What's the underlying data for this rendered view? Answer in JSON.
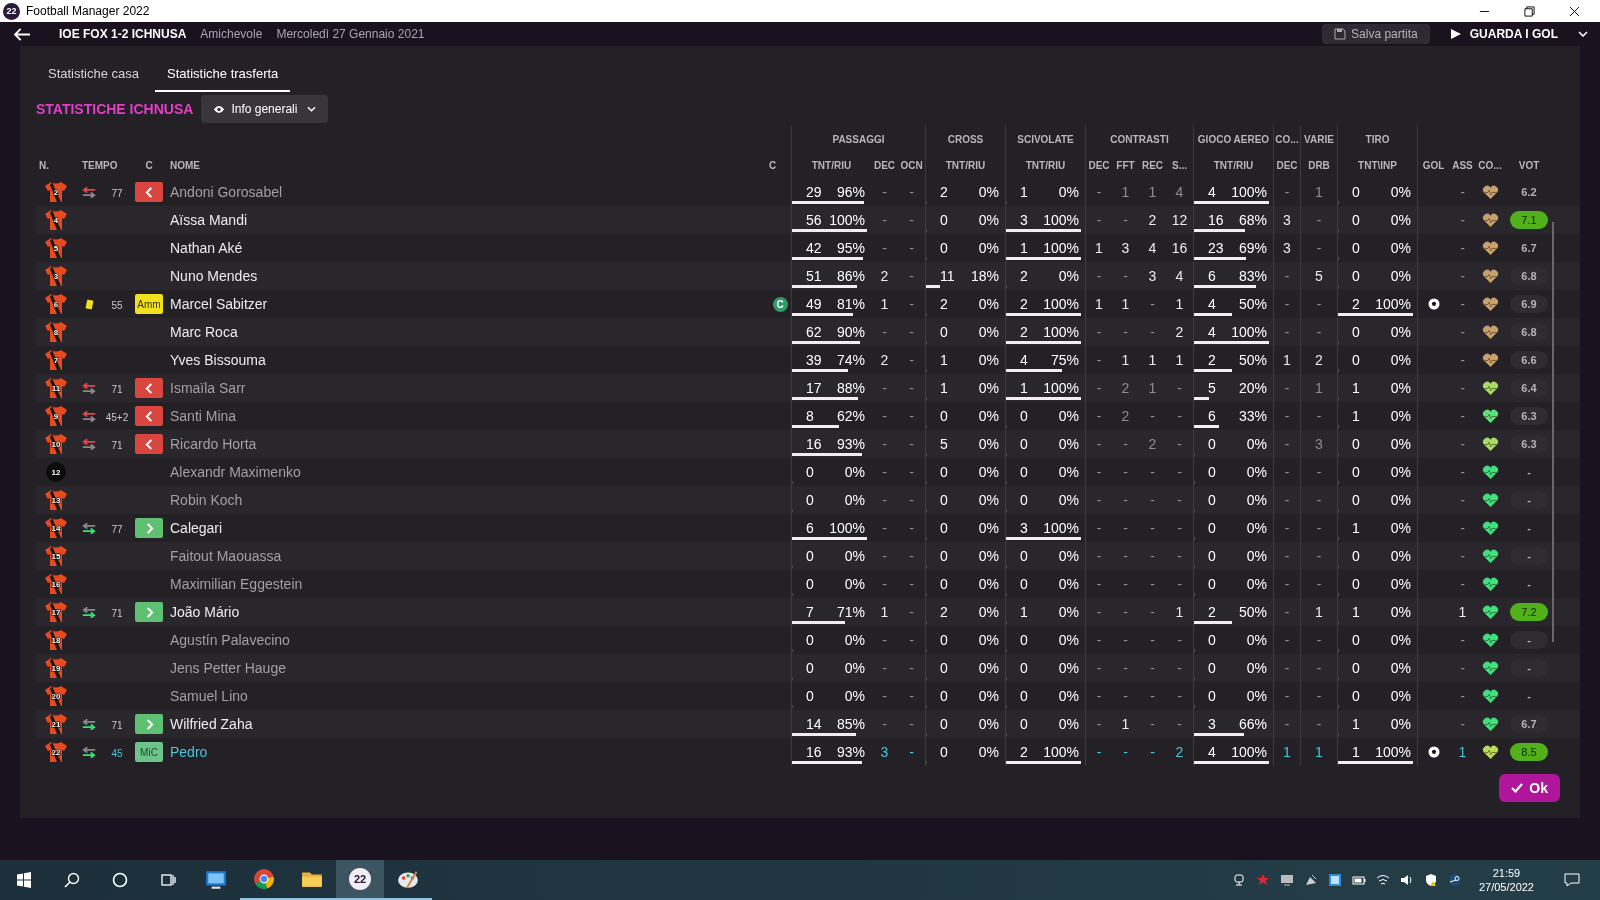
{
  "window": {
    "icon_text": "22",
    "title": "Football Manager 2022"
  },
  "match_header": {
    "score": "IOE FOX 1-2 ICHNUSA",
    "competition": "Amichevole",
    "date": "Mercoledì 27 Gennaio 2021",
    "save_button": "Salva partita",
    "goals_button": "GUARDA I GOL"
  },
  "tabs": [
    {
      "label": "Statistiche casa",
      "selected": false
    },
    {
      "label": "Statistiche trasferta",
      "selected": true
    }
  ],
  "team_title": "STATISTICHE ICHNUSA",
  "view_dropdown": {
    "value": "Info generali"
  },
  "table": {
    "left_columns": [
      "N.",
      "TEMPO",
      "C",
      "NOME",
      "C"
    ],
    "captain_label": "C",
    "groups": [
      {
        "label": "PASSAGGI",
        "columns": [
          {
            "label": "TNT/RIU",
            "kind": "bar"
          },
          {
            "label": "DEC",
            "kind": "num"
          },
          {
            "label": "OCN",
            "kind": "num"
          }
        ]
      },
      {
        "label": "CROSS",
        "columns": [
          {
            "label": "TNT/RIU",
            "kind": "bar"
          }
        ]
      },
      {
        "label": "SCIVOLATE",
        "columns": [
          {
            "label": "TNT/RIU",
            "kind": "bar"
          }
        ]
      },
      {
        "label": "CONTRASTI",
        "columns": [
          {
            "label": "DEC",
            "kind": "num"
          },
          {
            "label": "FFT",
            "kind": "num"
          },
          {
            "label": "REC",
            "kind": "num"
          },
          {
            "label": "S...",
            "kind": "num"
          }
        ]
      },
      {
        "label": "GIOCO AEREO",
        "columns": [
          {
            "label": "TNT/RIU",
            "kind": "bar"
          }
        ]
      },
      {
        "label": "CO...",
        "columns": [
          {
            "label": "DEC",
            "kind": "num"
          }
        ]
      },
      {
        "label": "VARIE",
        "columns": [
          {
            "label": "DRB",
            "kind": "wide"
          }
        ]
      },
      {
        "label": "TIRO",
        "columns": [
          {
            "label": "TNT\\INP",
            "kind": "bar"
          }
        ]
      },
      {
        "columns": [
          {
            "label": "GOL",
            "kind": "goal"
          },
          {
            "label": "ASS",
            "kind": "num"
          },
          {
            "label": "CO...",
            "kind": "heart"
          },
          {
            "label": "VOT",
            "kind": "vote"
          }
        ]
      }
    ],
    "rows": [
      {
        "number": "2",
        "keeper": false,
        "sub_off": true,
        "sub_on": false,
        "booked": false,
        "minute": "77",
        "badge": {
          "kind": "sub_off"
        },
        "name": "Andoni Gorosabel",
        "dimmed": true,
        "star": false,
        "captain": false,
        "cells": [
          {
            "tries": "29",
            "rate": "96%",
            "level": 0.96
          },
          "-",
          "-",
          {
            "tries": "2",
            "rate": "0%",
            "level": 0
          },
          {
            "tries": "1",
            "rate": "0%",
            "level": 0
          },
          "-",
          "1",
          "1",
          "4",
          {
            "tries": "4",
            "rate": "100%",
            "level": 1
          },
          "-",
          "1",
          {
            "tries": "0",
            "rate": "0%",
            "level": 0
          },
          {
            "goal": false
          },
          "-",
          {
            "color": "#c8a06c"
          },
          {
            "vote": "6.2",
            "kind": "plain"
          }
        ]
      },
      {
        "number": "4",
        "keeper": false,
        "sub_off": false,
        "sub_on": false,
        "booked": false,
        "badge": {
          "kind": "none"
        },
        "name": "Aïssa Mandi",
        "dimmed": false,
        "star": false,
        "captain": false,
        "cells": [
          {
            "tries": "56",
            "rate": "100%",
            "level": 1
          },
          "-",
          "-",
          {
            "tries": "0",
            "rate": "0%",
            "level": 0
          },
          {
            "tries": "3",
            "rate": "100%",
            "level": 1
          },
          "-",
          "-",
          "2",
          "12",
          {
            "tries": "16",
            "rate": "68%",
            "level": 0.68
          },
          "3",
          "-",
          {
            "tries": "0",
            "rate": "0%",
            "level": 0
          },
          {
            "goal": false
          },
          "-",
          {
            "color": "#c8a06c"
          },
          {
            "vote": "7.1",
            "kind": "high"
          }
        ]
      },
      {
        "number": "5",
        "keeper": false,
        "sub_off": false,
        "sub_on": false,
        "booked": false,
        "badge": {
          "kind": "none"
        },
        "name": "Nathan Aké",
        "dimmed": false,
        "star": false,
        "captain": false,
        "cells": [
          {
            "tries": "42",
            "rate": "95%",
            "level": 0.95
          },
          "-",
          "-",
          {
            "tries": "0",
            "rate": "0%",
            "level": 0
          },
          {
            "tries": "1",
            "rate": "100%",
            "level": 1
          },
          "1",
          "3",
          "4",
          "16",
          {
            "tries": "23",
            "rate": "69%",
            "level": 0.69
          },
          "3",
          "-",
          {
            "tries": "0",
            "rate": "0%",
            "level": 0
          },
          {
            "goal": false
          },
          "-",
          {
            "color": "#c8a06c"
          },
          {
            "vote": "6.7",
            "kind": "plain"
          }
        ]
      },
      {
        "number": "3",
        "keeper": false,
        "sub_off": false,
        "sub_on": false,
        "booked": false,
        "badge": {
          "kind": "none"
        },
        "name": "Nuno Mendes",
        "dimmed": false,
        "star": false,
        "captain": false,
        "cells": [
          {
            "tries": "51",
            "rate": "86%",
            "level": 0.86
          },
          "2",
          "-",
          {
            "tries": "11",
            "rate": "18%",
            "level": 0.18
          },
          {
            "tries": "2",
            "rate": "0%",
            "level": 0
          },
          "-",
          "-",
          "3",
          "4",
          {
            "tries": "6",
            "rate": "83%",
            "level": 0.83
          },
          "-",
          "5",
          {
            "tries": "0",
            "rate": "0%",
            "level": 0
          },
          {
            "goal": false
          },
          "-",
          {
            "color": "#c8a06c"
          },
          {
            "vote": "6.8",
            "kind": "pill"
          }
        ]
      },
      {
        "number": "6",
        "keeper": false,
        "sub_off": false,
        "sub_on": false,
        "booked": true,
        "minute": "55",
        "badge": {
          "kind": "card",
          "text": "Amm"
        },
        "name": "Marcel Sabitzer",
        "dimmed": false,
        "star": false,
        "captain": true,
        "cells": [
          {
            "tries": "49",
            "rate": "81%",
            "level": 0.81
          },
          "1",
          "-",
          {
            "tries": "2",
            "rate": "0%",
            "level": 0
          },
          {
            "tries": "2",
            "rate": "100%",
            "level": 1
          },
          "1",
          "1",
          "-",
          "1",
          {
            "tries": "4",
            "rate": "50%",
            "level": 0.5
          },
          "-",
          "-",
          {
            "tries": "2",
            "rate": "100%",
            "level": 1
          },
          {
            "goal": true
          },
          "-",
          {
            "color": "#c8a06c"
          },
          {
            "vote": "6.9",
            "kind": "pill"
          }
        ]
      },
      {
        "number": "8",
        "keeper": false,
        "sub_off": false,
        "sub_on": false,
        "booked": false,
        "badge": {
          "kind": "none"
        },
        "name": "Marc Roca",
        "dimmed": false,
        "star": false,
        "captain": false,
        "cells": [
          {
            "tries": "62",
            "rate": "90%",
            "level": 0.9
          },
          "-",
          "-",
          {
            "tries": "0",
            "rate": "0%",
            "level": 0
          },
          {
            "tries": "2",
            "rate": "100%",
            "level": 1
          },
          "-",
          "-",
          "-",
          "2",
          {
            "tries": "4",
            "rate": "100%",
            "level": 1
          },
          "-",
          "-",
          {
            "tries": "0",
            "rate": "0%",
            "level": 0
          },
          {
            "goal": false
          },
          "-",
          {
            "color": "#c8a06c"
          },
          {
            "vote": "6.8",
            "kind": "pill"
          }
        ]
      },
      {
        "number": "7",
        "keeper": false,
        "sub_off": false,
        "sub_on": false,
        "booked": false,
        "badge": {
          "kind": "none"
        },
        "name": "Yves Bissouma",
        "dimmed": false,
        "star": false,
        "captain": false,
        "cells": [
          {
            "tries": "39",
            "rate": "74%",
            "level": 0.74
          },
          "2",
          "-",
          {
            "tries": "1",
            "rate": "0%",
            "level": 0
          },
          {
            "tries": "4",
            "rate": "75%",
            "level": 0.75
          },
          "-",
          "1",
          "1",
          "1",
          {
            "tries": "2",
            "rate": "50%",
            "level": 0.5
          },
          "1",
          "2",
          {
            "tries": "0",
            "rate": "0%",
            "level": 0
          },
          {
            "goal": false
          },
          "-",
          {
            "color": "#c8a06c"
          },
          {
            "vote": "6.6",
            "kind": "pill"
          }
        ]
      },
      {
        "number": "11",
        "keeper": false,
        "sub_off": true,
        "sub_on": false,
        "booked": false,
        "minute": "71",
        "badge": {
          "kind": "sub_off"
        },
        "name": "Ismaïla Sarr",
        "dimmed": true,
        "star": false,
        "captain": false,
        "cells": [
          {
            "tries": "17",
            "rate": "88%",
            "level": 0.88
          },
          "-",
          "-",
          {
            "tries": "1",
            "rate": "0%",
            "level": 0
          },
          {
            "tries": "1",
            "rate": "100%",
            "level": 1
          },
          "-",
          "2",
          "1",
          "-",
          {
            "tries": "5",
            "rate": "20%",
            "level": 0.2
          },
          "-",
          "1",
          {
            "tries": "1",
            "rate": "0%",
            "level": 0
          },
          {
            "goal": false
          },
          "-",
          {
            "color": "#a6dc62"
          },
          {
            "vote": "6.4",
            "kind": "pill"
          }
        ]
      },
      {
        "number": "9",
        "keeper": false,
        "sub_off": true,
        "sub_on": false,
        "booked": false,
        "minute": "45+2",
        "badge": {
          "kind": "sub_off"
        },
        "name": "Santi Mina",
        "dimmed": true,
        "star": false,
        "captain": false,
        "cells": [
          {
            "tries": "8",
            "rate": "62%",
            "level": 0.62
          },
          "-",
          "-",
          {
            "tries": "0",
            "rate": "0%",
            "level": 0
          },
          {
            "tries": "0",
            "rate": "0%",
            "level": 0
          },
          "-",
          "2",
          "-",
          "-",
          {
            "tries": "6",
            "rate": "33%",
            "level": 0.33
          },
          "-",
          "-",
          {
            "tries": "1",
            "rate": "0%",
            "level": 0
          },
          {
            "goal": false
          },
          "-",
          {
            "color": "#5ee07a"
          },
          {
            "vote": "6.3",
            "kind": "pill"
          }
        ]
      },
      {
        "number": "10",
        "keeper": false,
        "sub_off": true,
        "sub_on": false,
        "booked": false,
        "minute": "71",
        "badge": {
          "kind": "sub_off"
        },
        "name": "Ricardo Horta",
        "dimmed": true,
        "star": false,
        "captain": false,
        "cells": [
          {
            "tries": "16",
            "rate": "93%",
            "level": 0.93
          },
          "-",
          "-",
          {
            "tries": "5",
            "rate": "0%",
            "level": 0
          },
          {
            "tries": "0",
            "rate": "0%",
            "level": 0
          },
          "-",
          "-",
          "2",
          "-",
          {
            "tries": "0",
            "rate": "0%",
            "level": 0
          },
          "-",
          "3",
          {
            "tries": "0",
            "rate": "0%",
            "level": 0
          },
          {
            "goal": false
          },
          "-",
          {
            "color": "#a6dc62"
          },
          {
            "vote": "6.3",
            "kind": "pill"
          }
        ]
      },
      {
        "number": "12",
        "keeper": true,
        "sub_off": false,
        "sub_on": false,
        "booked": false,
        "badge": {
          "kind": "none"
        },
        "name": "Alexandr Maximenko",
        "dimmed": true,
        "star": false,
        "captain": false,
        "cells": [
          {
            "tries": "0",
            "rate": "0%",
            "level": 0
          },
          "-",
          "-",
          {
            "tries": "0",
            "rate": "0%",
            "level": 0
          },
          {
            "tries": "0",
            "rate": "0%",
            "level": 0
          },
          "-",
          "-",
          "-",
          "-",
          {
            "tries": "0",
            "rate": "0%",
            "level": 0
          },
          "-",
          "-",
          {
            "tries": "0",
            "rate": "0%",
            "level": 0
          },
          {
            "goal": false
          },
          "-",
          {
            "color": "#3ee27c"
          },
          {
            "vote": "-",
            "kind": "plain"
          }
        ]
      },
      {
        "number": "13",
        "keeper": false,
        "sub_off": false,
        "sub_on": false,
        "booked": false,
        "badge": {
          "kind": "none"
        },
        "name": "Robin Koch",
        "dimmed": true,
        "star": false,
        "captain": false,
        "cells": [
          {
            "tries": "0",
            "rate": "0%",
            "level": 0
          },
          "-",
          "-",
          {
            "tries": "0",
            "rate": "0%",
            "level": 0
          },
          {
            "tries": "0",
            "rate": "0%",
            "level": 0
          },
          "-",
          "-",
          "-",
          "-",
          {
            "tries": "0",
            "rate": "0%",
            "level": 0
          },
          "-",
          "-",
          {
            "tries": "0",
            "rate": "0%",
            "level": 0
          },
          {
            "goal": false
          },
          "-",
          {
            "color": "#3ee27c"
          },
          {
            "vote": "-",
            "kind": "pill"
          }
        ]
      },
      {
        "number": "14",
        "keeper": false,
        "sub_off": false,
        "sub_on": true,
        "booked": false,
        "minute": "77",
        "badge": {
          "kind": "sub_on"
        },
        "name": "Calegari",
        "dimmed": false,
        "star": false,
        "captain": false,
        "cells": [
          {
            "tries": "6",
            "rate": "100%",
            "level": 1
          },
          "-",
          "-",
          {
            "tries": "0",
            "rate": "0%",
            "level": 0
          },
          {
            "tries": "3",
            "rate": "100%",
            "level": 1
          },
          "-",
          "-",
          "-",
          "-",
          {
            "tries": "0",
            "rate": "0%",
            "level": 0
          },
          "-",
          "-",
          {
            "tries": "1",
            "rate": "0%",
            "level": 0
          },
          {
            "goal": false
          },
          "-",
          {
            "color": "#3ee27c"
          },
          {
            "vote": "-",
            "kind": "plain"
          }
        ]
      },
      {
        "number": "15",
        "keeper": false,
        "sub_off": false,
        "sub_on": false,
        "booked": false,
        "badge": {
          "kind": "none"
        },
        "name": "Faitout Maouassa",
        "dimmed": true,
        "star": false,
        "captain": false,
        "cells": [
          {
            "tries": "0",
            "rate": "0%",
            "level": 0
          },
          "-",
          "-",
          {
            "tries": "0",
            "rate": "0%",
            "level": 0
          },
          {
            "tries": "0",
            "rate": "0%",
            "level": 0
          },
          "-",
          "-",
          "-",
          "-",
          {
            "tries": "0",
            "rate": "0%",
            "level": 0
          },
          "-",
          "-",
          {
            "tries": "0",
            "rate": "0%",
            "level": 0
          },
          {
            "goal": false
          },
          "-",
          {
            "color": "#3ee27c"
          },
          {
            "vote": "-",
            "kind": "pill"
          }
        ]
      },
      {
        "number": "16",
        "keeper": false,
        "sub_off": false,
        "sub_on": false,
        "booked": false,
        "badge": {
          "kind": "none"
        },
        "name": "Maximilian Eggestein",
        "dimmed": true,
        "star": false,
        "captain": false,
        "cells": [
          {
            "tries": "0",
            "rate": "0%",
            "level": 0
          },
          "-",
          "-",
          {
            "tries": "0",
            "rate": "0%",
            "level": 0
          },
          {
            "tries": "0",
            "rate": "0%",
            "level": 0
          },
          "-",
          "-",
          "-",
          "-",
          {
            "tries": "0",
            "rate": "0%",
            "level": 0
          },
          "-",
          "-",
          {
            "tries": "0",
            "rate": "0%",
            "level": 0
          },
          {
            "goal": false
          },
          "-",
          {
            "color": "#3ee27c"
          },
          {
            "vote": "-",
            "kind": "plain"
          }
        ]
      },
      {
        "number": "17",
        "keeper": false,
        "sub_off": false,
        "sub_on": true,
        "booked": false,
        "minute": "71",
        "badge": {
          "kind": "sub_on"
        },
        "name": "João Mário",
        "dimmed": false,
        "star": false,
        "captain": false,
        "cells": [
          {
            "tries": "7",
            "rate": "71%",
            "level": 0.71
          },
          "1",
          "-",
          {
            "tries": "2",
            "rate": "0%",
            "level": 0
          },
          {
            "tries": "1",
            "rate": "0%",
            "level": 0
          },
          "-",
          "-",
          "-",
          "1",
          {
            "tries": "2",
            "rate": "50%",
            "level": 0.5
          },
          "-",
          "1",
          {
            "tries": "1",
            "rate": "0%",
            "level": 0
          },
          {
            "goal": false
          },
          "1",
          {
            "color": "#3ee27c"
          },
          {
            "vote": "7.2",
            "kind": "high"
          }
        ]
      },
      {
        "number": "18",
        "keeper": false,
        "sub_off": false,
        "sub_on": false,
        "booked": false,
        "badge": {
          "kind": "none"
        },
        "name": "Agustín Palavecino",
        "dimmed": true,
        "star": false,
        "captain": false,
        "cells": [
          {
            "tries": "0",
            "rate": "0%",
            "level": 0
          },
          "-",
          "-",
          {
            "tries": "0",
            "rate": "0%",
            "level": 0
          },
          {
            "tries": "0",
            "rate": "0%",
            "level": 0
          },
          "-",
          "-",
          "-",
          "-",
          {
            "tries": "0",
            "rate": "0%",
            "level": 0
          },
          "-",
          "-",
          {
            "tries": "0",
            "rate": "0%",
            "level": 0
          },
          {
            "goal": false
          },
          "-",
          {
            "color": "#3ee27c"
          },
          {
            "vote": "-",
            "kind": "pill"
          }
        ]
      },
      {
        "number": "19",
        "keeper": false,
        "sub_off": false,
        "sub_on": false,
        "booked": false,
        "badge": {
          "kind": "none"
        },
        "name": "Jens Petter Hauge",
        "dimmed": true,
        "star": false,
        "captain": false,
        "cells": [
          {
            "tries": "0",
            "rate": "0%",
            "level": 0
          },
          "-",
          "-",
          {
            "tries": "0",
            "rate": "0%",
            "level": 0
          },
          {
            "tries": "0",
            "rate": "0%",
            "level": 0
          },
          "-",
          "-",
          "-",
          "-",
          {
            "tries": "0",
            "rate": "0%",
            "level": 0
          },
          "-",
          "-",
          {
            "tries": "0",
            "rate": "0%",
            "level": 0
          },
          {
            "goal": false
          },
          "-",
          {
            "color": "#3ee27c"
          },
          {
            "vote": "-",
            "kind": "pill"
          }
        ]
      },
      {
        "number": "20",
        "keeper": false,
        "sub_off": false,
        "sub_on": false,
        "booked": false,
        "badge": {
          "kind": "none"
        },
        "name": "Samuel Lino",
        "dimmed": true,
        "star": false,
        "captain": false,
        "cells": [
          {
            "tries": "0",
            "rate": "0%",
            "level": 0
          },
          "-",
          "-",
          {
            "tries": "0",
            "rate": "0%",
            "level": 0
          },
          {
            "tries": "0",
            "rate": "0%",
            "level": 0
          },
          "-",
          "-",
          "-",
          "-",
          {
            "tries": "0",
            "rate": "0%",
            "level": 0
          },
          "-",
          "-",
          {
            "tries": "0",
            "rate": "0%",
            "level": 0
          },
          {
            "goal": false
          },
          "-",
          {
            "color": "#3ee27c"
          },
          {
            "vote": "-",
            "kind": "plain"
          }
        ]
      },
      {
        "number": "21",
        "keeper": false,
        "sub_off": false,
        "sub_on": true,
        "booked": false,
        "minute": "71",
        "badge": {
          "kind": "sub_on"
        },
        "name": "Wilfried Zaha",
        "dimmed": false,
        "star": false,
        "captain": false,
        "cells": [
          {
            "tries": "14",
            "rate": "85%",
            "level": 0.85
          },
          "-",
          "-",
          {
            "tries": "0",
            "rate": "0%",
            "level": 0
          },
          {
            "tries": "0",
            "rate": "0%",
            "level": 0
          },
          "-",
          "1",
          "-",
          "-",
          {
            "tries": "3",
            "rate": "66%",
            "level": 0.66
          },
          "-",
          "-",
          {
            "tries": "1",
            "rate": "0%",
            "level": 0
          },
          {
            "goal": false
          },
          "-",
          {
            "color": "#3ee27c"
          },
          {
            "vote": "6.7",
            "kind": "pill"
          }
        ]
      },
      {
        "number": "22",
        "keeper": false,
        "sub_off": false,
        "sub_on": true,
        "booked": false,
        "minute": "45",
        "badge": {
          "kind": "role",
          "text": "MiC"
        },
        "name": "Pedro",
        "dimmed": false,
        "star": true,
        "captain": false,
        "cells": [
          {
            "tries": "16",
            "rate": "93%",
            "level": 0.93
          },
          "3",
          "-",
          {
            "tries": "0",
            "rate": "0%",
            "level": 0
          },
          {
            "tries": "2",
            "rate": "100%",
            "level": 1
          },
          "-",
          "-",
          "-",
          "2",
          {
            "tries": "4",
            "rate": "100%",
            "level": 1
          },
          "1",
          "1",
          {
            "tries": "1",
            "rate": "100%",
            "level": 1
          },
          {
            "goal": true
          },
          "1",
          {
            "color": "#b9dc58"
          },
          {
            "vote": "8.5",
            "kind": "high"
          }
        ]
      }
    ]
  },
  "ok_button": "Ok",
  "taskbar": {
    "apps": [
      {
        "kind": "remote",
        "running": false,
        "selected": false
      },
      {
        "kind": "chrome",
        "running": true,
        "selected": false
      },
      {
        "kind": "folder",
        "running": true,
        "selected": false
      },
      {
        "kind": "fm",
        "text": "22",
        "running": true,
        "selected": true
      },
      {
        "kind": "paint",
        "running": true,
        "selected": false
      }
    ],
    "time": "21:59",
    "date": "27/05/2022"
  }
}
